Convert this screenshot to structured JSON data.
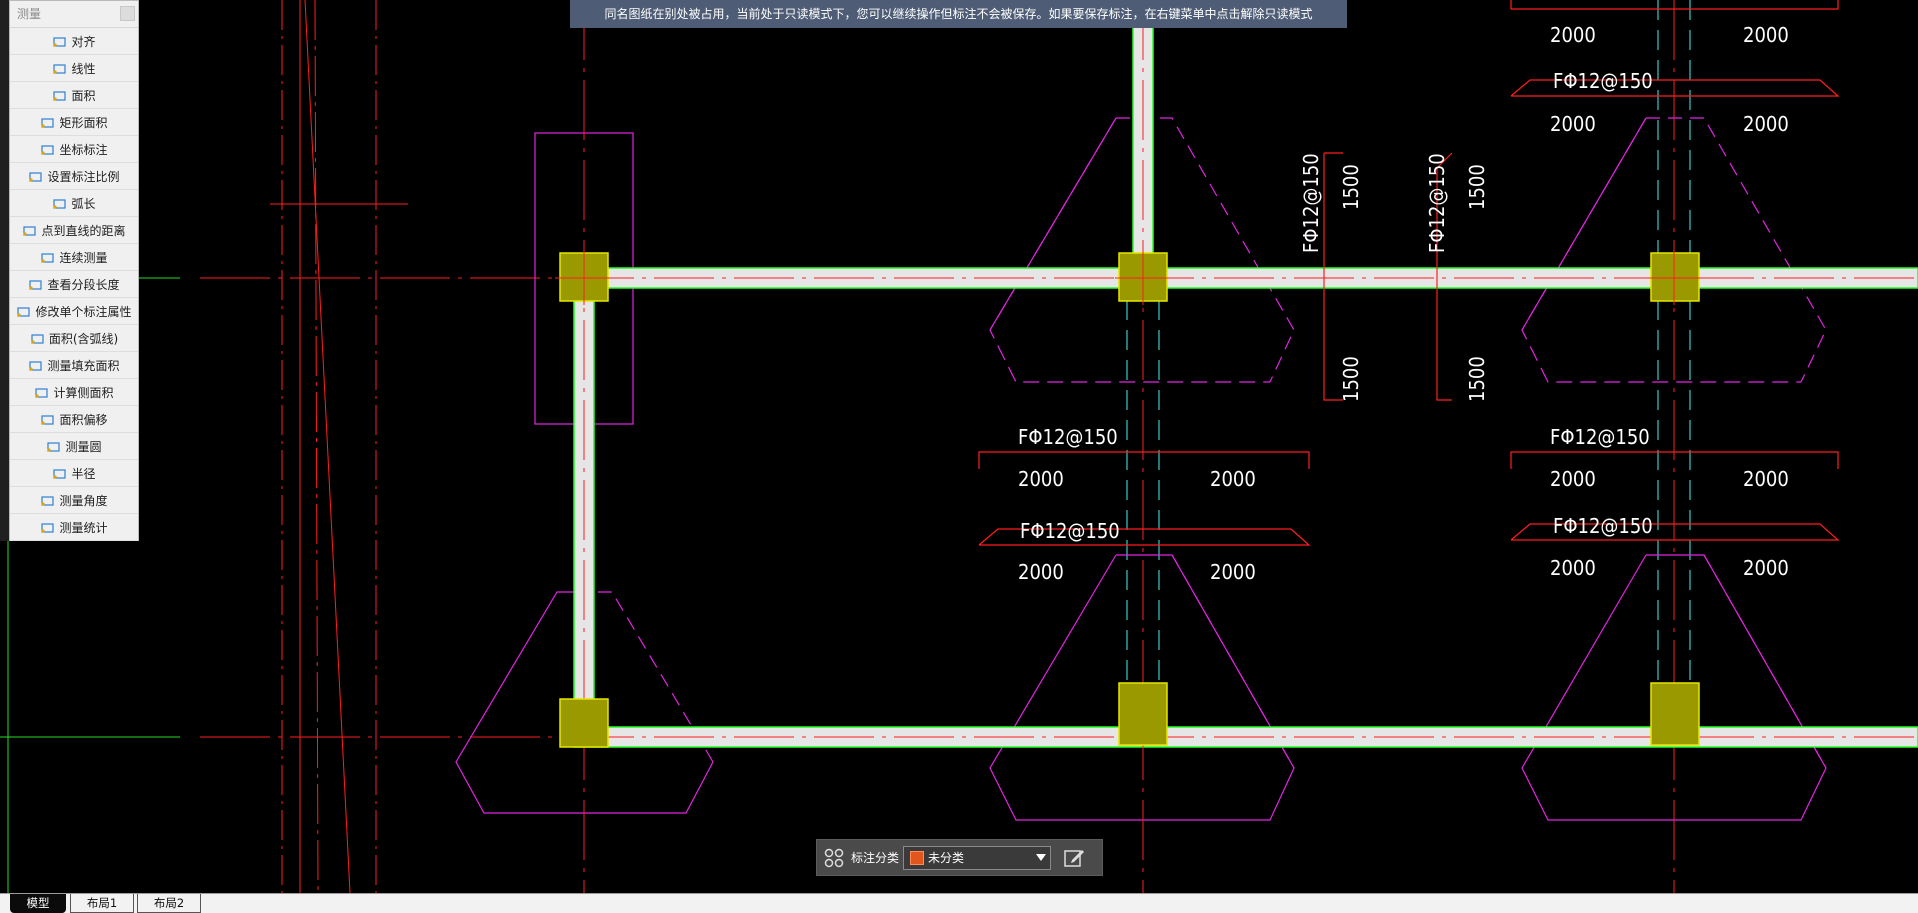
{
  "measure_panel": {
    "title": "测量",
    "tools": [
      {
        "label": "对齐",
        "icon": "align-dimension-icon"
      },
      {
        "label": "线性",
        "icon": "linear-dimension-icon"
      },
      {
        "label": "面积",
        "icon": "area-icon"
      },
      {
        "label": "矩形面积",
        "icon": "rectangle-area-icon"
      },
      {
        "label": "坐标标注",
        "icon": "coordinate-icon"
      },
      {
        "label": "设置标注比例",
        "icon": "scale-icon"
      },
      {
        "label": "弧长",
        "icon": "arc-length-icon"
      },
      {
        "label": "点到直线的距离",
        "icon": "point-to-line-icon"
      },
      {
        "label": "连续测量",
        "icon": "continuous-measure-icon"
      },
      {
        "label": "查看分段长度",
        "icon": "segment-length-icon"
      },
      {
        "label": "修改单个标注属性",
        "icon": "edit-annotation-icon"
      },
      {
        "label": "面积(含弧线)",
        "icon": "arc-area-icon"
      },
      {
        "label": "测量填充面积",
        "icon": "fill-area-icon"
      },
      {
        "label": "计算侧面积",
        "icon": "side-area-icon"
      },
      {
        "label": "面积偏移",
        "icon": "area-offset-icon"
      },
      {
        "label": "测量圆",
        "icon": "circle-measure-icon"
      },
      {
        "label": "半径",
        "icon": "radius-icon"
      },
      {
        "label": "测量角度",
        "icon": "angle-icon"
      },
      {
        "label": "测量统计",
        "icon": "statistics-icon"
      }
    ]
  },
  "notice": "同名图纸在别处被占用，当前处于只读模式下，您可以继续操作但标注不会被保存。如果要保存标注，在右键菜单中点击解除只读模式",
  "drawing": {
    "rebar_label": "FΦ12@150",
    "dim_2000": "2000",
    "dim_1500": "1500"
  },
  "annotation_toolbar": {
    "label": "标注分类",
    "selected": "未分类",
    "swatch_color": "#e2551b"
  },
  "tabs": [
    "模型",
    "布局1",
    "布局2"
  ],
  "colors": {
    "beam_fill": "#e6e6e6",
    "beam_edge": "#22ff22",
    "column_fill": "#9a9a00",
    "axis_red": "#ff1e1e",
    "footing_magenta": "#e224e2",
    "cyan_dash": "#2aa3a3",
    "notice_bg": "#4e5d75"
  }
}
